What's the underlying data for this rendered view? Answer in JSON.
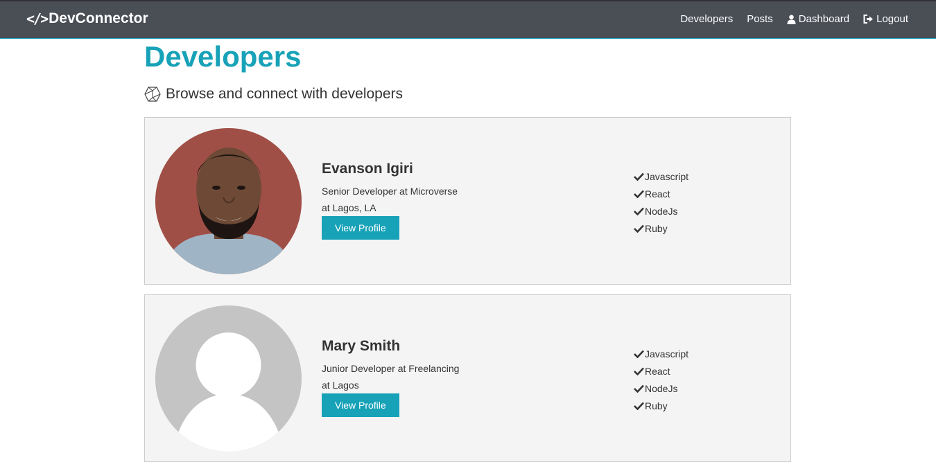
{
  "navbar": {
    "brand_icon": "</>",
    "brand": "DevConnector",
    "links": {
      "developers": "Developers",
      "posts": "Posts",
      "dashboard": "Dashboard",
      "logout": "Logout"
    }
  },
  "page": {
    "title": "Developers",
    "lead": "Browse and connect with developers"
  },
  "profiles": [
    {
      "name": "Evanson Igiri",
      "role": "Senior Developer at Microverse",
      "location": "at Lagos, LA",
      "button": "View Profile",
      "avatar": "photo",
      "skills": [
        "Javascript",
        "React",
        "NodeJs",
        "Ruby"
      ]
    },
    {
      "name": "Mary Smith",
      "role": "Junior Developer at Freelancing",
      "location": "at Lagos",
      "button": "View Profile",
      "avatar": "default-avatar",
      "skills": [
        "Javascript",
        "React",
        "NodeJs",
        "Ruby"
      ]
    }
  ],
  "colors": {
    "primary": "#17a2b8",
    "navbar": "#4a4e55",
    "card": "#f4f4f4"
  }
}
